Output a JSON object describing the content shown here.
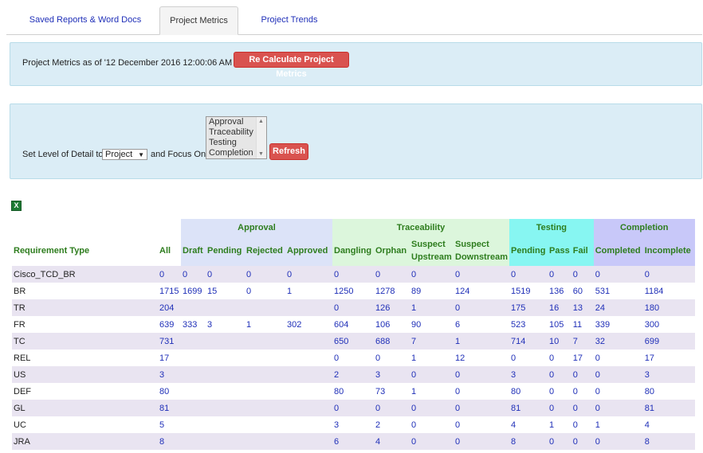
{
  "tabs": [
    {
      "label": "Saved Reports & Word Docs"
    },
    {
      "label": "Project Metrics"
    },
    {
      "label": "Project Trends"
    }
  ],
  "metrics_panel": {
    "text": "Project Metrics as of '12 December 2016 12:00:06 AM '",
    "recalc_label": "Re Calculate Project Metrics"
  },
  "detail_panel": {
    "label_before": "Set Level of Detail to",
    "level_value": "Project",
    "label_after": "and Focus On",
    "focus_options": [
      "Approval",
      "Traceability",
      "Testing",
      "Completion"
    ],
    "refresh_label": "Refresh"
  },
  "table": {
    "groups": {
      "approval": "Approval",
      "traceability": "Traceability",
      "testing": "Testing",
      "completion": "Completion"
    },
    "headers": {
      "req_type": "Requirement Type",
      "all": "All",
      "draft": "Draft",
      "pending": "Pending",
      "rejected": "Rejected",
      "approved": "Approved",
      "dangling": "Dangling",
      "orphan": "Orphan",
      "suspect_up_1": "Suspect",
      "suspect_up_2": "Upstream",
      "suspect_down_1": "Suspect",
      "suspect_down_2": "Downstream",
      "test_pending": "Pending",
      "pass": "Pass",
      "fail": "Fail",
      "completed": "Completed",
      "incomplete": "Incomplete"
    },
    "rows": [
      [
        "Cisco_TCD_BR",
        "0",
        "0",
        "0",
        "0",
        "0",
        "0",
        "0",
        "0",
        "0",
        "0",
        "0",
        "0",
        "0",
        "0"
      ],
      [
        "BR",
        "1715",
        "1699",
        "15",
        "0",
        "1",
        "1250",
        "1278",
        "89",
        "124",
        "1519",
        "136",
        "60",
        "531",
        "1184"
      ],
      [
        "TR",
        "204",
        "",
        "",
        "",
        "",
        "0",
        "126",
        "1",
        "0",
        "175",
        "16",
        "13",
        "24",
        "180"
      ],
      [
        "FR",
        "639",
        "333",
        "3",
        "1",
        "302",
        "604",
        "106",
        "90",
        "6",
        "523",
        "105",
        "11",
        "339",
        "300"
      ],
      [
        "TC",
        "731",
        "",
        "",
        "",
        "",
        "650",
        "688",
        "7",
        "1",
        "714",
        "10",
        "7",
        "32",
        "699"
      ],
      [
        "REL",
        "17",
        "",
        "",
        "",
        "",
        "0",
        "0",
        "1",
        "12",
        "0",
        "0",
        "17",
        "0",
        "17"
      ],
      [
        "US",
        "3",
        "",
        "",
        "",
        "",
        "2",
        "3",
        "0",
        "0",
        "3",
        "0",
        "0",
        "0",
        "3"
      ],
      [
        "DEF",
        "80",
        "",
        "",
        "",
        "",
        "80",
        "73",
        "1",
        "0",
        "80",
        "0",
        "0",
        "0",
        "80"
      ],
      [
        "GL",
        "81",
        "",
        "",
        "",
        "",
        "0",
        "0",
        "0",
        "0",
        "81",
        "0",
        "0",
        "0",
        "81"
      ],
      [
        "UC",
        "5",
        "",
        "",
        "",
        "",
        "3",
        "2",
        "0",
        "0",
        "4",
        "1",
        "0",
        "1",
        "4"
      ],
      [
        "JRA",
        "8",
        "",
        "",
        "",
        "",
        "6",
        "4",
        "0",
        "0",
        "8",
        "0",
        "0",
        "0",
        "8"
      ]
    ]
  }
}
